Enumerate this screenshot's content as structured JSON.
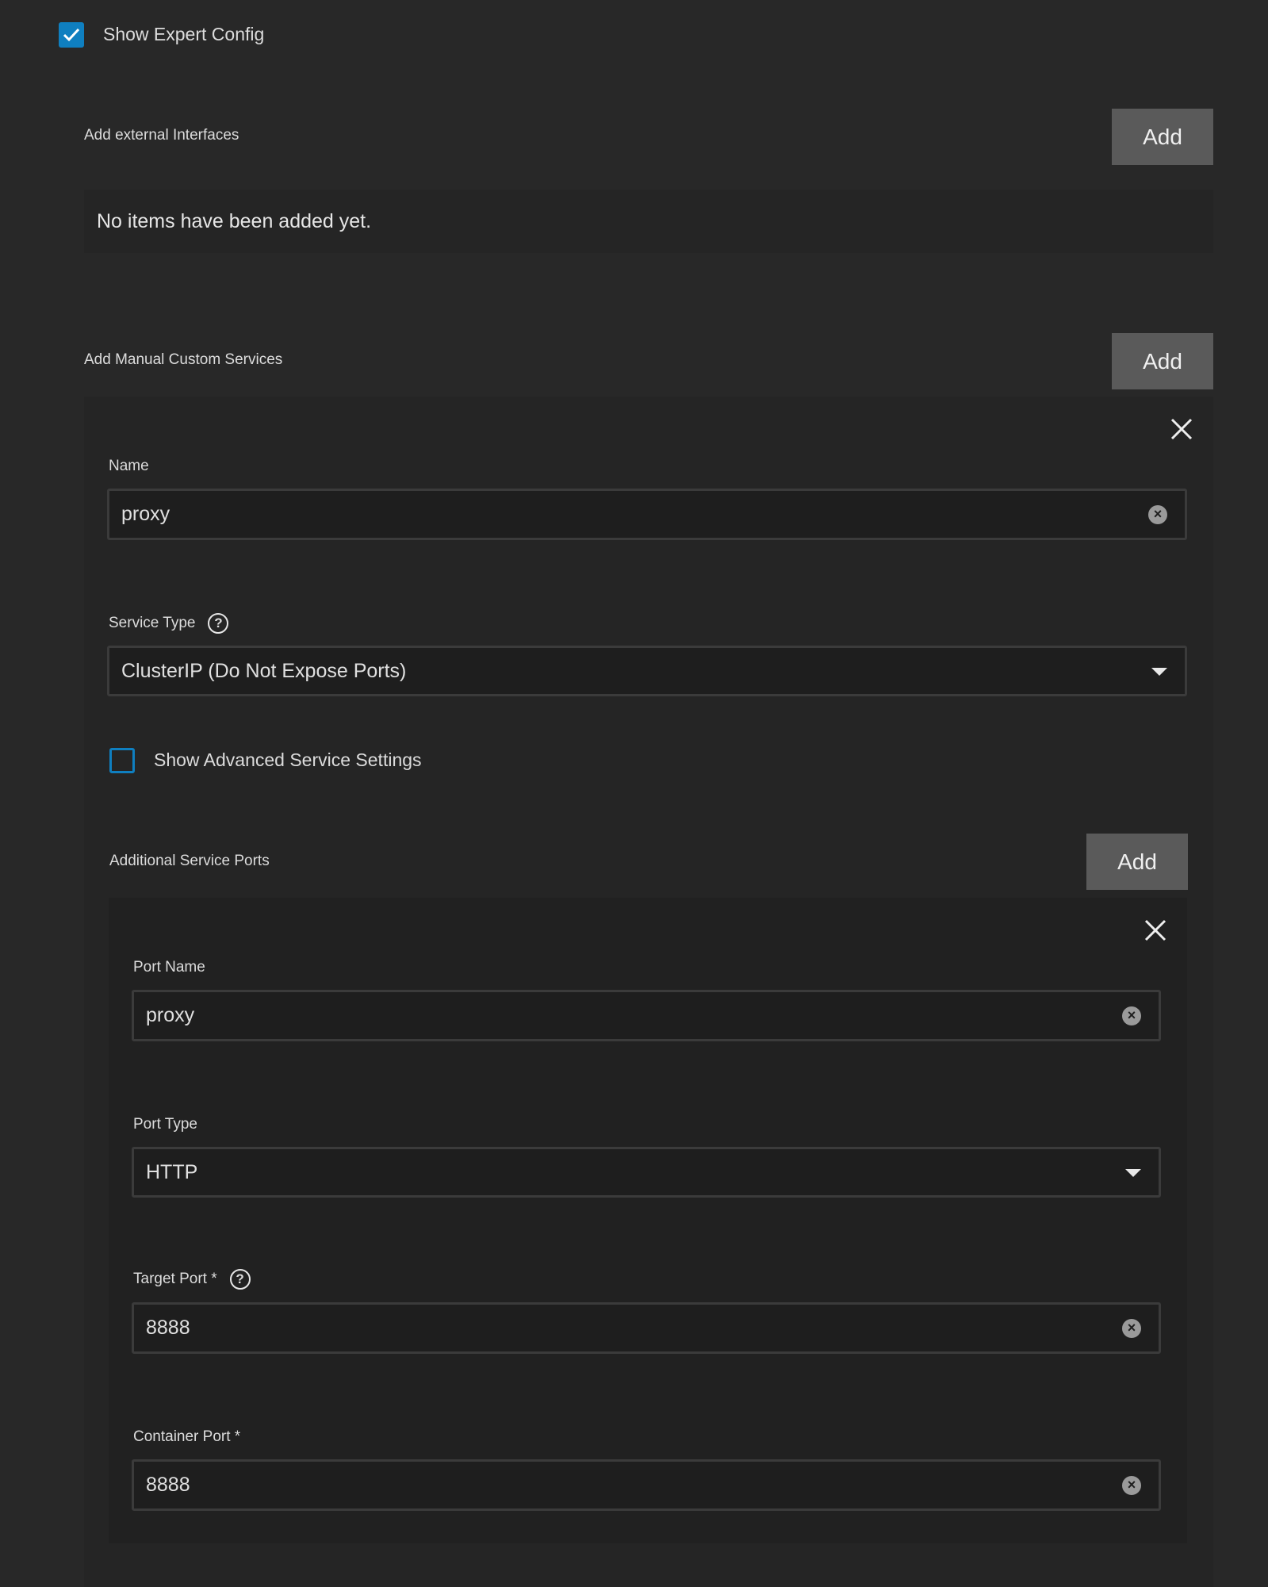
{
  "expert_config": {
    "label": "Show Expert Config",
    "checked": true
  },
  "external_interfaces": {
    "label": "Add external Interfaces",
    "add_label": "Add",
    "empty_text": "No items have been added yet."
  },
  "custom_services": {
    "label": "Add Manual Custom Services",
    "add_label": "Add",
    "item": {
      "name_label": "Name",
      "name_value": "proxy",
      "service_type_label": "Service Type",
      "service_type_value": "ClusterIP (Do Not Expose Ports)",
      "advanced_label": "Show Advanced Service Settings",
      "advanced_checked": false,
      "ports_label": "Additional Service Ports",
      "ports_add_label": "Add",
      "port": {
        "port_name_label": "Port Name",
        "port_name_value": "proxy",
        "port_type_label": "Port Type",
        "port_type_value": "HTTP",
        "target_port_label": "Target Port *",
        "target_port_value": "8888",
        "container_port_label": "Container Port *",
        "container_port_value": "8888"
      }
    }
  },
  "icons": {
    "help": "?",
    "clear": "×"
  }
}
